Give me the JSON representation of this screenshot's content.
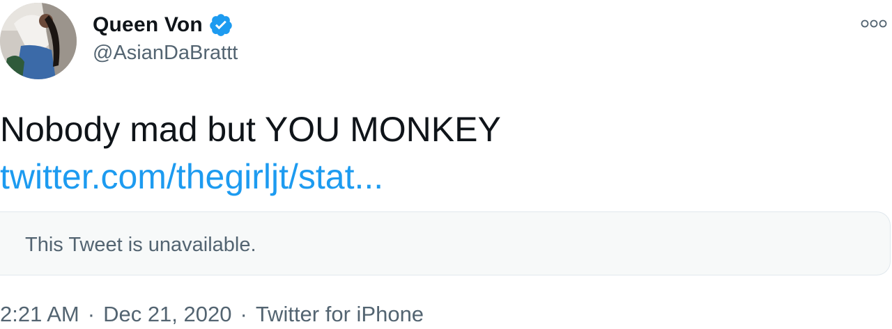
{
  "author": {
    "display_name": "Queen Von",
    "handle": "@AsianDaBrattt",
    "verified": true
  },
  "icons": {
    "verified": "verified-badge-icon",
    "more": "more-options-icon"
  },
  "tweet": {
    "text": "Nobody mad but YOU MONKEY",
    "link": "twitter.com/thegirljt/stat..."
  },
  "quote": {
    "text": "This Tweet is unavailable."
  },
  "meta": {
    "time": "2:21 AM",
    "date": "Dec 21, 2020",
    "separator": "·",
    "source": "Twitter for iPhone"
  },
  "colors": {
    "link": "#1d9bf0",
    "verified": "#1d9bf0",
    "secondary_text": "#536471",
    "primary_text": "#0f1419"
  }
}
